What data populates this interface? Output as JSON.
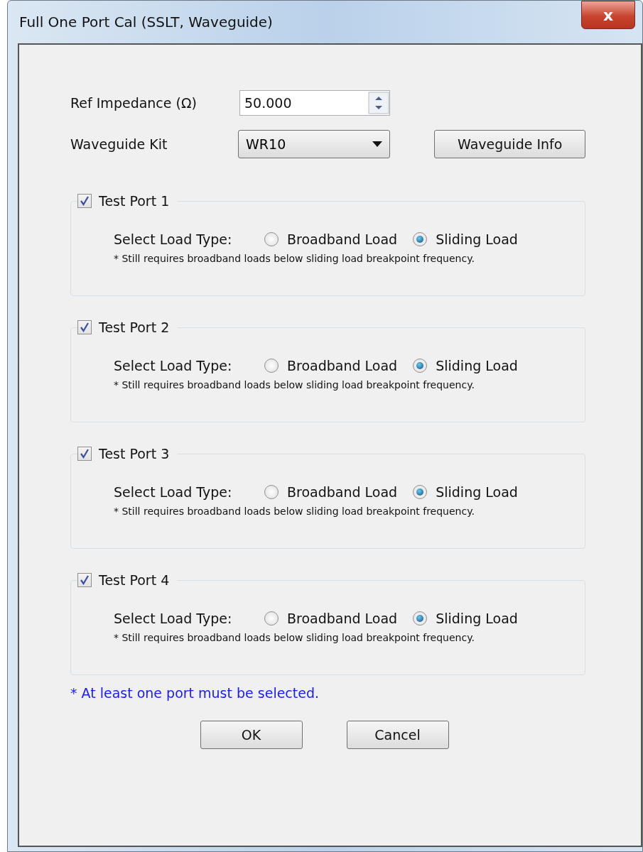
{
  "window": {
    "title": "Full One Port Cal (SSLT, Waveguide)",
    "close": "x"
  },
  "ref_impedance": {
    "label": "Ref Impedance (Ω)",
    "value": "50.000"
  },
  "waveguide_kit": {
    "label": "Waveguide  Kit",
    "value": "WR10"
  },
  "info_button": "Waveguide Info",
  "ports": [
    {
      "label": "Test Port 1",
      "checked": true,
      "load_label": "Select Load Type:",
      "options": [
        {
          "label": "Broadband Load",
          "selected": false
        },
        {
          "label": "Sliding Load",
          "selected": true
        }
      ],
      "note": "* Still requires broadband loads below sliding load breakpoint frequency."
    },
    {
      "label": "Test Port 2",
      "checked": true,
      "load_label": "Select Load Type:",
      "options": [
        {
          "label": "Broadband Load",
          "selected": false
        },
        {
          "label": "Sliding Load",
          "selected": true
        }
      ],
      "note": "* Still requires broadband loads below sliding load breakpoint frequency."
    },
    {
      "label": "Test Port 3",
      "checked": true,
      "load_label": "Select Load Type:",
      "options": [
        {
          "label": "Broadband Load",
          "selected": false
        },
        {
          "label": "Sliding Load",
          "selected": true
        }
      ],
      "note": "* Still requires broadband loads below sliding load breakpoint frequency."
    },
    {
      "label": "Test Port 4",
      "checked": true,
      "load_label": "Select Load Type:",
      "options": [
        {
          "label": "Broadband Load",
          "selected": false
        },
        {
          "label": "Sliding Load",
          "selected": true
        }
      ],
      "note": "* Still requires broadband loads below sliding load breakpoint frequency."
    }
  ],
  "footer_note": "* At least one port must be selected.",
  "buttons": [
    "OK",
    "Cancel"
  ]
}
